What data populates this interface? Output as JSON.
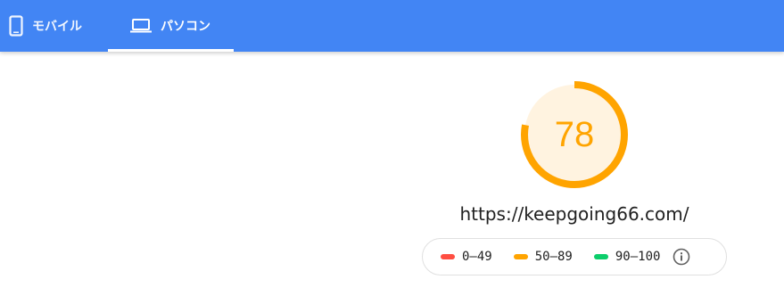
{
  "tabs": [
    {
      "label": "モバイル",
      "icon": "smartphone-icon",
      "selected": false
    },
    {
      "label": "パソコン",
      "icon": "laptop-icon",
      "selected": true
    }
  ],
  "score": {
    "value": "78",
    "percent": 78,
    "color": "#ffa400",
    "background": "#fff3e0"
  },
  "url": "https://keepgoing66.com/",
  "legend": {
    "items": [
      {
        "range": "0–49",
        "color": "#ff4e42"
      },
      {
        "range": "50–89",
        "color": "#ffa400"
      },
      {
        "range": "90–100",
        "color": "#0cce6b"
      }
    ],
    "info_icon": "info-icon"
  },
  "colors": {
    "header": "#4285f4"
  }
}
